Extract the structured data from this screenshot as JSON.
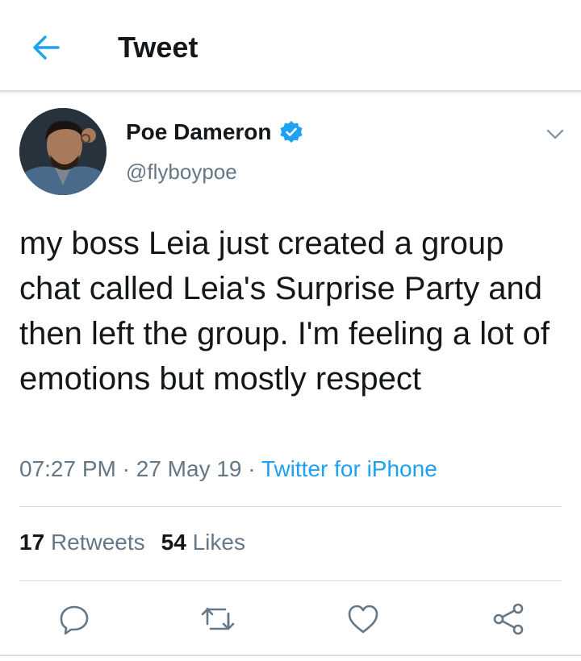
{
  "header": {
    "title": "Tweet",
    "back_icon": "arrow-left-icon"
  },
  "accent_color": "#1da1f2",
  "text_color": "#14171a",
  "secondary_color": "#657786",
  "tweet": {
    "author": {
      "name": "Poe Dameron",
      "handle": "@flyboypoe",
      "verified": true
    },
    "text": "my boss Leia just created a group chat called Leia's Surprise Party and then left the group. I'm feeling a lot of emotions but mostly respect",
    "time": "07:27 PM",
    "sep1": " · ",
    "date": "27 May 19",
    "sep2": " · ",
    "source": "Twitter for iPhone"
  },
  "stats": {
    "retweets_count": "17",
    "retweets_label": "Retweets",
    "likes_count": "54",
    "likes_label": "Likes"
  },
  "actions": [
    "reply-icon",
    "retweet-icon",
    "like-icon",
    "share-icon"
  ]
}
